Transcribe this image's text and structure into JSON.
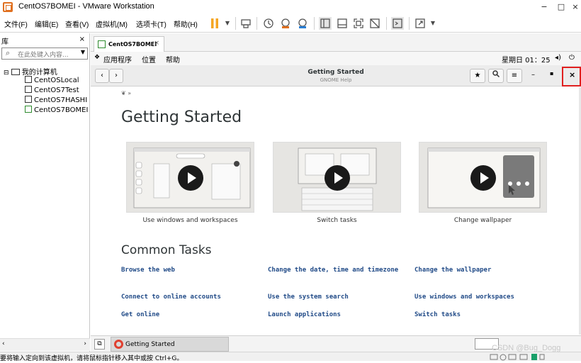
{
  "window": {
    "title": "CentOS7BOMEI - VMware Workstation",
    "controls": [
      "−",
      "□",
      "×"
    ]
  },
  "menubar": {
    "items": [
      "文件(F)",
      "编辑(E)",
      "查看(V)",
      "虚拟机(M)",
      "选项卡(T)",
      "帮助(H)"
    ]
  },
  "library": {
    "title": "库",
    "close": "×",
    "search_placeholder": "在此处键入内容...",
    "root": "我的计算机",
    "vms": [
      "CentOSLocal",
      "CentOS7Test",
      "CentOS7HASHI",
      "CentOS7BOMEI"
    ]
  },
  "vm_tab": {
    "label": "CentOS7BOMEI",
    "close": "×"
  },
  "gnome_topbar": {
    "applications": "应用程序",
    "places": "位置",
    "help": "帮助",
    "clock": "星期日 01：25"
  },
  "help_window": {
    "title": "Getting Started",
    "subtitle": "GNOME Help",
    "close": "×"
  },
  "page": {
    "heading": "Getting Started",
    "videos": [
      {
        "caption": "Use windows and workspaces"
      },
      {
        "caption": "Switch tasks"
      },
      {
        "caption": "Change wallpaper"
      }
    ],
    "common_tasks_heading": "Common Tasks",
    "tasks": [
      [
        "Browse the web",
        "Change the date, time and timezone",
        "Change the wallpaper"
      ],
      [
        "Connect to online accounts",
        "Use the system search",
        "Use windows and workspaces"
      ],
      [
        "Get online",
        "Launch applications",
        "Switch tasks"
      ]
    ]
  },
  "guest_taskbar": {
    "window_label": "Getting Started"
  },
  "statusbar": {
    "message": "要将输入定向到该虚拟机，请将鼠标指针移入其中或按 Ctrl+G。",
    "watermark": "CSDN @Bug_Dogg"
  },
  "colors": {
    "link": "#204a87",
    "highlight": "#e02020",
    "pause": "#f5a623"
  }
}
